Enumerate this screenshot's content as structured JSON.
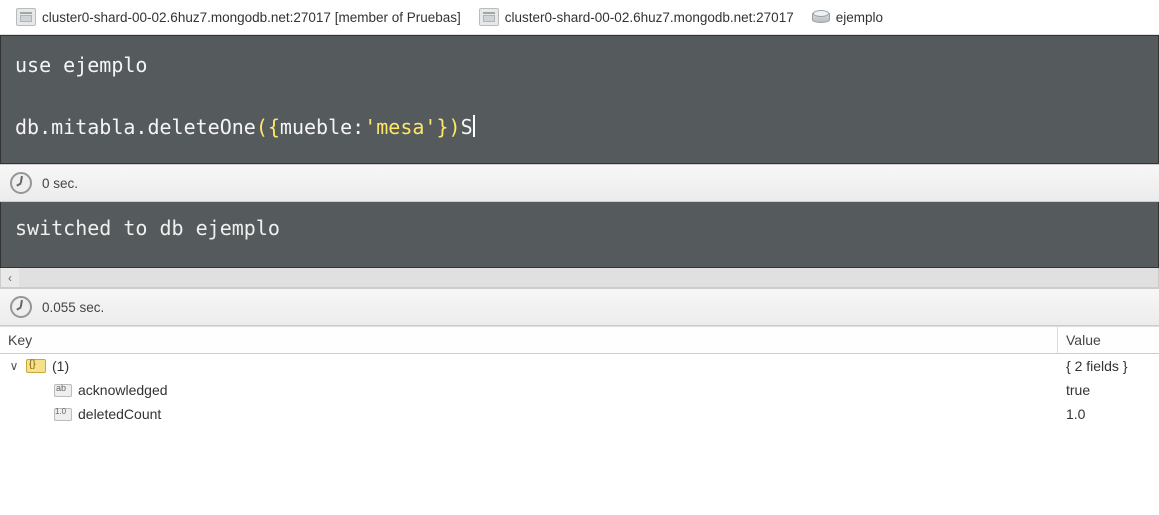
{
  "breadcrumb": {
    "server": "cluster0-shard-00-02.6huz7.mongodb.net:27017 [member of Pruebas]",
    "host": "cluster0-shard-00-02.6huz7.mongodb.net:27017",
    "db": "ejemplo"
  },
  "editor": {
    "line1_kw": "use",
    "line1_name": "ejemplo",
    "line2_pre": "db.mitabla.deleteOne",
    "line2_paren_open": "(",
    "line2_brace_open": "{",
    "line2_key": "mueble:",
    "line2_str": "'mesa'",
    "line2_brace_close": "}",
    "line2_paren_close": ")",
    "line2_tail": "S"
  },
  "timing1": "0 sec.",
  "output1": "switched to db ejemplo",
  "timing2": "0.055 sec.",
  "headers": {
    "key": "Key",
    "value": "Value"
  },
  "rows": {
    "root": {
      "label": "(1)",
      "value": "{ 2 fields }"
    },
    "r1": {
      "label": "acknowledged",
      "value": "true"
    },
    "r2": {
      "label": "deletedCount",
      "value": "1.0"
    }
  }
}
